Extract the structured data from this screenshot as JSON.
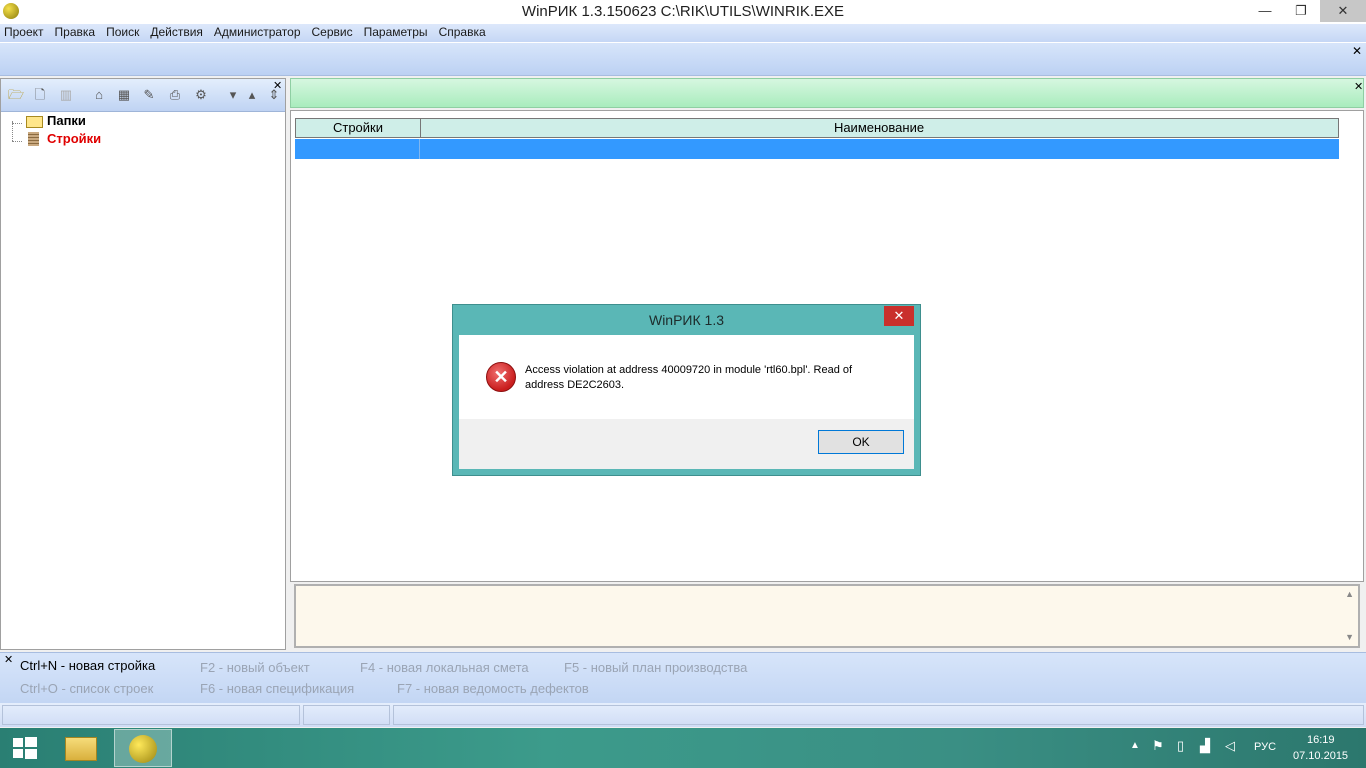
{
  "window": {
    "title": "WinРИК 1.3.150623    C:\\RIK\\UTILS\\WINRIK.EXE",
    "minimize_glyph": "—",
    "maximize_glyph": "❐",
    "close_glyph": "✕"
  },
  "menu": [
    "Проект",
    "Правка",
    "Поиск",
    "Действия",
    "Администратор",
    "Сервис",
    "Параметры",
    "Справка"
  ],
  "tree": {
    "items": [
      {
        "label": "Папки",
        "color": "#000000"
      },
      {
        "label": "Стройки",
        "color": "#e00000"
      }
    ]
  },
  "grid": {
    "columns": [
      "Стройки",
      "Наименование"
    ]
  },
  "hints": {
    "row1": [
      "Ctrl+N - новая стройка",
      "F2 - новый объект",
      "F4 - новая локальная смета",
      "F5 - новый план производства"
    ],
    "row2": [
      "Ctrl+O - список строек",
      "F6 - новая спецификация",
      "F7 - новая ведомость дефектов"
    ]
  },
  "dialog": {
    "title": "WinРИК 1.3",
    "message": "Access violation at address 40009720 in module 'rtl60.bpl'. Read of address DE2C2603.",
    "ok_label": "OK",
    "close_glyph": "✕",
    "error_glyph": "✕"
  },
  "taskbar": {
    "language": "РУС",
    "time": "16:19",
    "date": "07.10.2015"
  },
  "colors": {
    "selection": "#3399ff",
    "grid_header": "#cfeee8",
    "right_header": "#a9ecbd",
    "dialog_frame": "#5ab7b6"
  }
}
